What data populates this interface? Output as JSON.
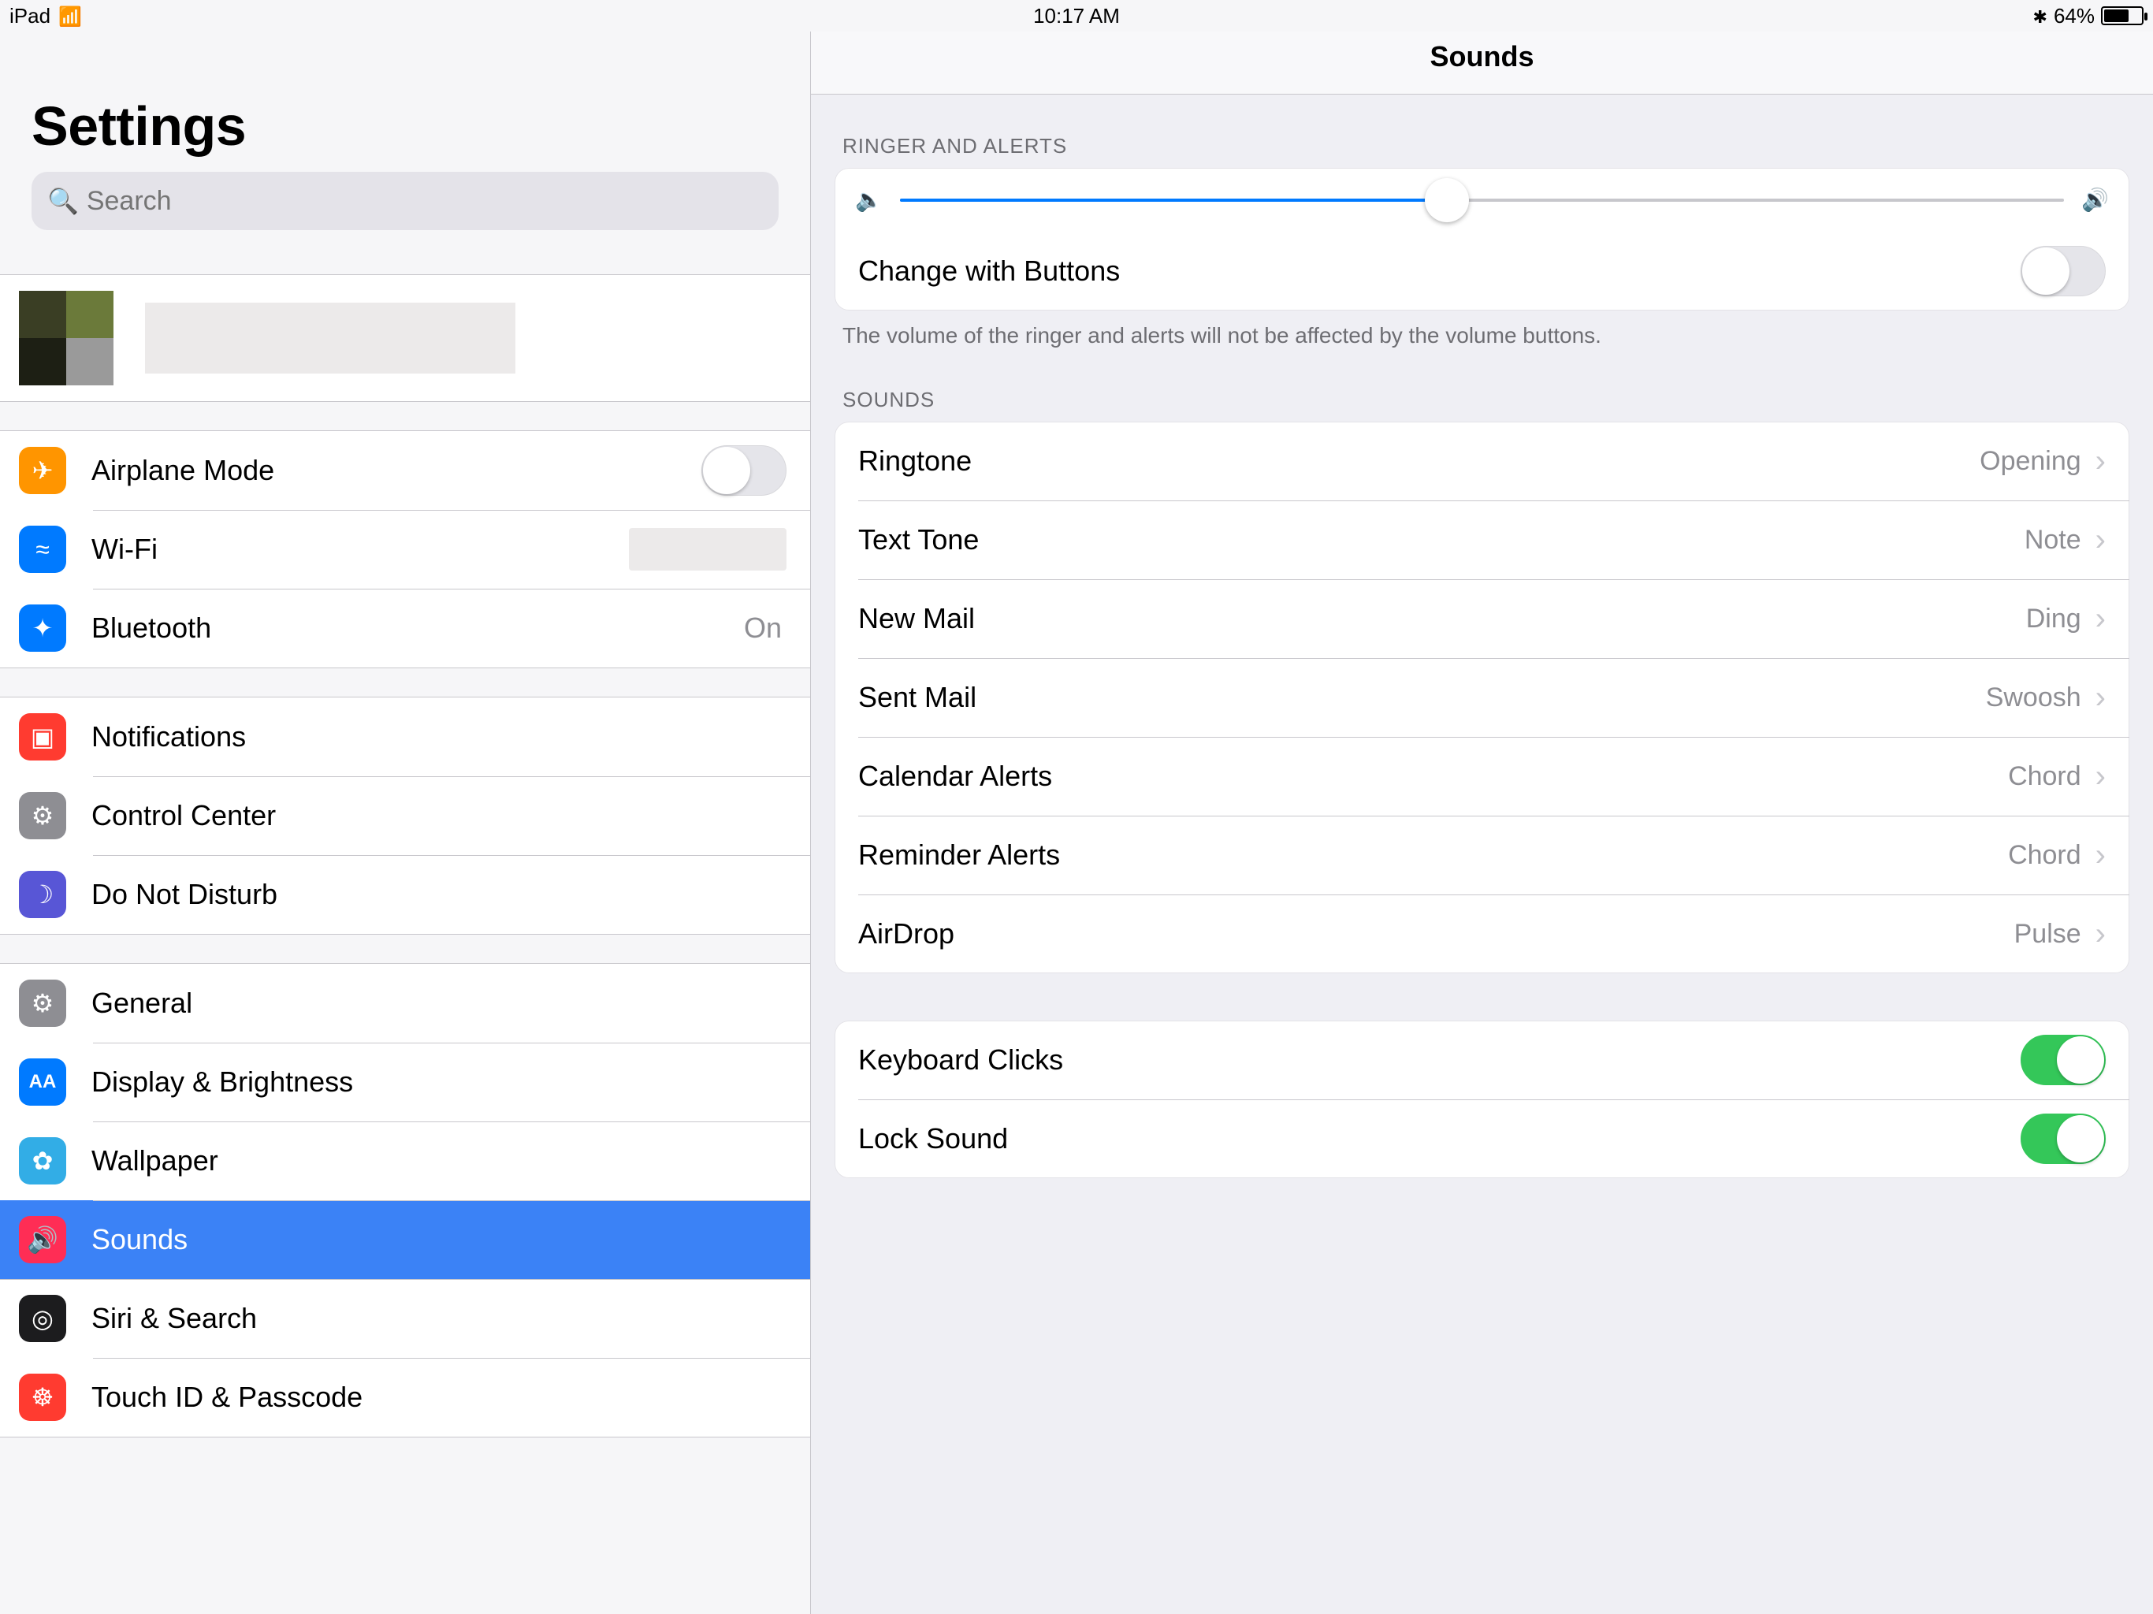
{
  "statusbar": {
    "device": "iPad",
    "time": "10:17 AM",
    "battery_pct": "64%",
    "battery_fill": 64
  },
  "sidebar": {
    "title": "Settings",
    "search_placeholder": "Search",
    "items": {
      "airplane": "Airplane Mode",
      "wifi": "Wi-Fi",
      "bluetooth": "Bluetooth",
      "bluetooth_val": "On",
      "notifications": "Notifications",
      "controlcenter": "Control Center",
      "dnd": "Do Not Disturb",
      "general": "General",
      "display": "Display & Brightness",
      "wallpaper": "Wallpaper",
      "sounds": "Sounds",
      "siri": "Siri & Search",
      "touchid": "Touch ID & Passcode"
    }
  },
  "detail": {
    "title": "Sounds",
    "sec_ringer": "RINGER AND ALERTS",
    "slider_pct": 47,
    "change_buttons": "Change with Buttons",
    "change_buttons_on": false,
    "footer1": "The volume of the ringer and alerts will not be affected by the volume buttons.",
    "sec_sounds": "SOUNDS",
    "rows": [
      {
        "label": "Ringtone",
        "val": "Opening"
      },
      {
        "label": "Text Tone",
        "val": "Note"
      },
      {
        "label": "New Mail",
        "val": "Ding"
      },
      {
        "label": "Sent Mail",
        "val": "Swoosh"
      },
      {
        "label": "Calendar Alerts",
        "val": "Chord"
      },
      {
        "label": "Reminder Alerts",
        "val": "Chord"
      },
      {
        "label": "AirDrop",
        "val": "Pulse"
      }
    ],
    "keyboard": "Keyboard Clicks",
    "keyboard_on": true,
    "lock": "Lock Sound",
    "lock_on": true
  }
}
